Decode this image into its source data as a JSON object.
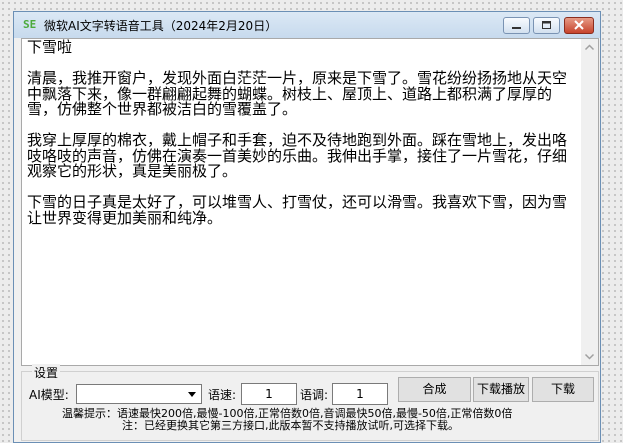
{
  "window": {
    "title": "微软AI文字转语音工具（2024年2月20日）"
  },
  "text": {
    "paragraphs": [
      "下雪啦",
      "清晨，我推开窗户，发现外面白茫茫一片，原来是下雪了。雪花纷纷扬扬地从天空中飘落下来，像一群翩翩起舞的蝴蝶。树枝上、屋顶上、道路上都积满了厚厚的雪，仿佛整个世界都被洁白的雪覆盖了。",
      "我穿上厚厚的棉衣，戴上帽子和手套，迫不及待地跑到外面。踩在雪地上，发出咯吱咯吱的声音，仿佛在演奏一首美妙的乐曲。我伸出手掌，接住了一片雪花，仔细观察它的形状，真是美丽极了。",
      "下雪的日子真是太好了，可以堆雪人、打雪仗，还可以滑雪。我喜欢下雪，因为雪让世界变得更加美丽和纯净。"
    ]
  },
  "settings": {
    "group_title": "设置",
    "model_label": "AI模型:",
    "model_value": "",
    "speed_label": "语速:",
    "speed_value": "1",
    "tone_label": "语调:",
    "tone_value": "1",
    "synthesize_label": "合成",
    "download_play_label": "下载播放",
    "download_label": "下载",
    "tip_line1": "温馨提示：语速最快200倍,最慢-100倍,正常倍数0倍,音调最快50倍,最慢-50倍,正常倍数0倍",
    "tip_line2": "注：已经更换其它第三方接口,此版本暂不支持播放试听,可选择下载。"
  }
}
